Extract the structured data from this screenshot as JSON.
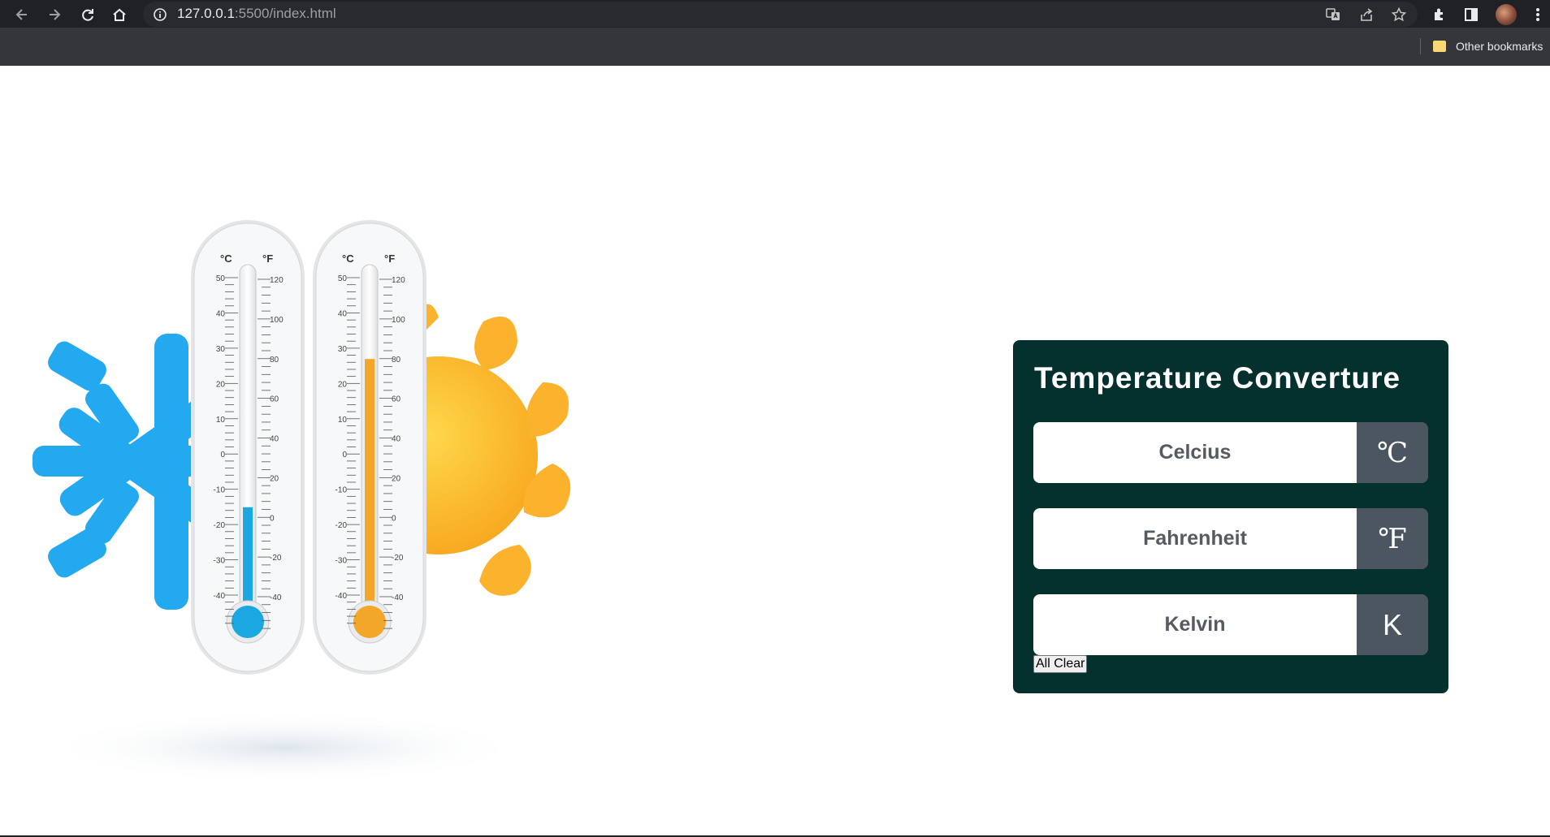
{
  "browser": {
    "url_host": "127.0.0.1",
    "url_rest": ":5500/index.html",
    "bookmarks": {
      "other_label": "Other bookmarks"
    }
  },
  "illustration": {
    "thermometer_left": {
      "celsius_label": "°C",
      "fahrenheit_label": "°F",
      "celsius_ticks": [
        "50",
        "40",
        "30",
        "20",
        "10",
        "0",
        "-10",
        "-20",
        "-30",
        "-40"
      ],
      "fahrenheit_ticks": [
        "120",
        "100",
        "80",
        "60",
        "40",
        "20",
        "0",
        "-20",
        "-40"
      ],
      "fill_fraction": 0.28,
      "fill_color": "#1ba8e0"
    },
    "thermometer_right": {
      "celsius_label": "°C",
      "fahrenheit_label": "°F",
      "celsius_ticks": [
        "50",
        "40",
        "30",
        "20",
        "10",
        "0",
        "-10",
        "-20",
        "-30",
        "-40"
      ],
      "fahrenheit_ticks": [
        "120",
        "100",
        "80",
        "60",
        "40",
        "20",
        "0",
        "-20",
        "-40"
      ],
      "fill_fraction": 0.72,
      "fill_color": "#f2a72a"
    },
    "colors": {
      "snowflake": "#23a9f0",
      "sun": "#fdb92e"
    }
  },
  "converter": {
    "title": "Temperature Converture",
    "celsius": {
      "placeholder": "Celcius",
      "unit": "℃"
    },
    "fahrenheit": {
      "placeholder": "Fahrenheit",
      "unit": "℉"
    },
    "kelvin": {
      "placeholder": "Kelvin",
      "unit": "K"
    },
    "clear_label": "All Clear"
  },
  "colors": {
    "card_bg": "#04302d",
    "unit_bg": "#4b5661"
  }
}
